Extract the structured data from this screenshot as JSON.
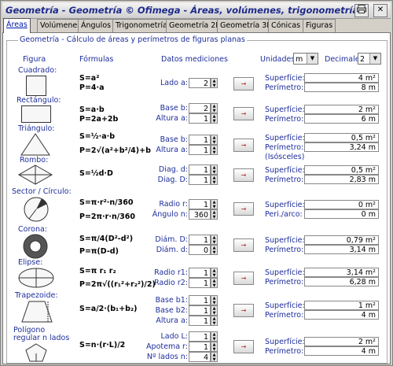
{
  "window": {
    "title": "Geometría - Geometría  © Ofimega - Áreas, volúmenes, trigonometría..."
  },
  "tabs": [
    "Áreas",
    "Volúmenes",
    "Ángulos",
    "Trigonometría",
    "Geometría 2D",
    "Geometría 3D",
    "Cónicas",
    "Figuras"
  ],
  "group": {
    "title": "Geometría - Cálculo de áreas y perímetros de figuras planas"
  },
  "headers": {
    "figura": "Figura",
    "formulas": "Fórmulas",
    "datos": "Datos mediciones",
    "unidades": "Unidades:",
    "decimales": "Decimales:"
  },
  "unidades_value": "m",
  "decimales_value": "2",
  "calc_icon": "arrow-right-icon",
  "shapes": [
    {
      "name": "Cuadrado:",
      "formula": [
        "S=a²",
        "P=4·a"
      ],
      "params": [
        {
          "label": "Lado a:",
          "value": "2"
        }
      ],
      "results": [
        {
          "label": "Superfície:",
          "value": "4 m²"
        },
        {
          "label": "Perímetro:",
          "value": "8 m"
        }
      ]
    },
    {
      "name": "Rectángulo:",
      "formula": [
        "S=a·b",
        "P=2a+2b"
      ],
      "params": [
        {
          "label": "Base b:",
          "value": "2"
        },
        {
          "label": "Altura a:",
          "value": "1"
        }
      ],
      "results": [
        {
          "label": "Superfície:",
          "value": "2 m²"
        },
        {
          "label": "Perímetro:",
          "value": "6 m"
        }
      ]
    },
    {
      "name": "Triángulo:",
      "formula": [
        "S=½·a·b",
        "P=2√(a²+b²/4)+b"
      ],
      "params": [
        {
          "label": "Base b:",
          "value": "1"
        },
        {
          "label": "Altura a:",
          "value": "1"
        }
      ],
      "results": [
        {
          "label": "Superfície:",
          "value": "0,5 m²"
        },
        {
          "label": "Perímetro:",
          "value": "3,24 m"
        }
      ],
      "note": "(Isósceles)"
    },
    {
      "name": "Rombo:",
      "formula": [
        "S=½d·D"
      ],
      "params": [
        {
          "label": "Diag. d:",
          "value": "1"
        },
        {
          "label": "Diag. D:",
          "value": "1"
        }
      ],
      "results": [
        {
          "label": "Superfície:",
          "value": "0,5 m²"
        },
        {
          "label": "Perímetro:",
          "value": "2,83 m"
        }
      ]
    },
    {
      "name": "Sector / Círculo:",
      "formula": [
        "S=π·r²·n/360",
        "P=2π·r·n/360"
      ],
      "params": [
        {
          "label": "Radio r:",
          "value": "1"
        },
        {
          "label": "Ángulo n:",
          "value": "360"
        }
      ],
      "results": [
        {
          "label": "Superfície:",
          "value": "0 m²"
        },
        {
          "label": "Peri./arco:",
          "value": "0 m"
        }
      ]
    },
    {
      "name": "Corona:",
      "formula": [
        "S=π/4(D²-d²)",
        "P=π(D-d)"
      ],
      "params": [
        {
          "label": "Diám. D:",
          "value": "1"
        },
        {
          "label": "Diám. d:",
          "value": "0"
        }
      ],
      "results": [
        {
          "label": "Superfície:",
          "value": "0,79 m²"
        },
        {
          "label": "Perímetro:",
          "value": "3,14 m"
        }
      ]
    },
    {
      "name": "Elipse:",
      "formula": [
        "S=π r₁ r₂",
        "P=2π√((r₁²+r₂²)/2)"
      ],
      "params": [
        {
          "label": "Radio r1:",
          "value": "1"
        },
        {
          "label": "Radio r2:",
          "value": "1"
        }
      ],
      "results": [
        {
          "label": "Superfície:",
          "value": "3,14 m²"
        },
        {
          "label": "Perímetro:",
          "value": "6,28 m"
        }
      ]
    },
    {
      "name": "Trapezoide:",
      "formula": [
        "S=a/2·(b₁+b₂)"
      ],
      "params": [
        {
          "label": "Base b1:",
          "value": "1"
        },
        {
          "label": "Base b2:",
          "value": "1"
        },
        {
          "label": "Altura a:",
          "value": "1"
        }
      ],
      "results": [
        {
          "label": "Superfície:",
          "value": "1 m²"
        },
        {
          "label": "Perímetro:",
          "value": "4 m"
        }
      ]
    },
    {
      "name": "Polígono regular n lados",
      "formula": [
        "S=n·(r·L)/2"
      ],
      "params": [
        {
          "label": "Lado L:",
          "value": "1"
        },
        {
          "label": "Apotema r:",
          "value": "1"
        },
        {
          "label": "Nº lados n:",
          "value": "4"
        }
      ],
      "results": [
        {
          "label": "Superfície:",
          "value": "2 m²"
        },
        {
          "label": "Perímetro:",
          "value": "4 m"
        }
      ]
    }
  ]
}
